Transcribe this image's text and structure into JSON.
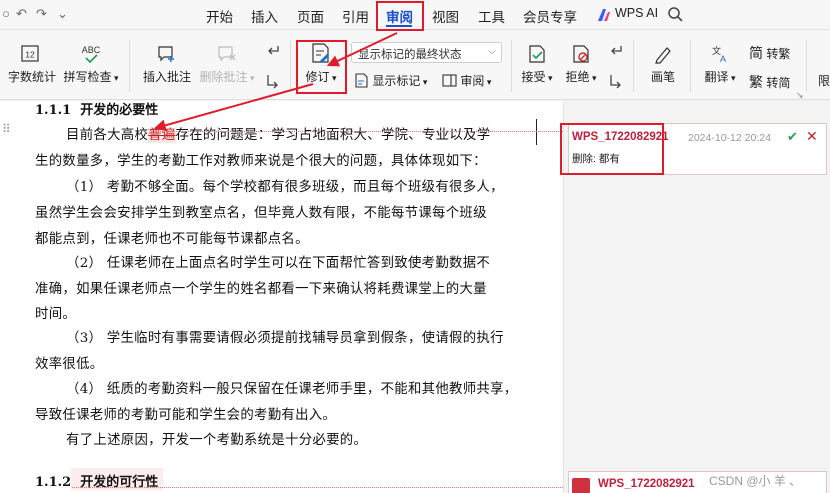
{
  "quick_access": {
    "dot": "○",
    "undo": "↶",
    "redo": "↷",
    "more": "⌄"
  },
  "menu": {
    "tabs": [
      "开始",
      "插入",
      "页面",
      "引用",
      "审阅",
      "视图",
      "工具",
      "会员专享"
    ],
    "active_tab": "审阅",
    "wps_ai_label": "WPS AI",
    "search_icon": "search-icon"
  },
  "ribbon": {
    "word_count": {
      "icon_text": "12",
      "label": "字数统计"
    },
    "spell_check": {
      "icon_text": "ABC",
      "label": "拼写检查"
    },
    "insert_comment": "插入批注",
    "delete_comment": "删除批注",
    "track_changes": "修订",
    "display_mode": "显示标记的最终状态",
    "show_markup": "显示标记",
    "review_pane": "审阅",
    "accept": "接受",
    "reject": "拒绝",
    "pen": "画笔",
    "translate": "翻译",
    "to_traditional": {
      "glyph": "简",
      "label": "转繁"
    },
    "to_simplified": {
      "glyph": "繁",
      "label": "转简"
    },
    "cut_label": "限"
  },
  "document": {
    "heading1_prefix": "1.1.1",
    "heading1_text": "开发的必要性",
    "para1_line1_before": "目前各大高校",
    "para1_line1_deleted": "普遍",
    "para1_line1_after": "存在的问题是：学习占地面积大、学院、专业以及学",
    "lines": [
      "生的数量多，学生的考勤工作对教师来说是个很大的问题，具体体现如下：",
      "（1） 考勤不够全面。每个学校都有很多班级，而且每个班级有很多人，",
      "虽然学生会会安排学生到教室点名，但毕竟人数有限，不能每节课每个班级",
      "都能点到，任课老师也不可能每节课都点名。",
      "（2） 任课老师在上面点名时学生可以在下面帮忙答到致使考勤数据不",
      "准确，如果任课老师点一个学生的姓名都看一下来确认将耗费课堂上的大量",
      "时间。",
      "（3） 学生临时有事需要请假必须提前找辅导员拿到假条，使请假的执行",
      "效率很低。",
      "（4） 纸质的考勤资料一般只保留在任课老师手里，不能和其他教师共享，",
      "导致任课老师的考勤可能和学生会的考勤有出入。",
      "有了上述原因，开发一个考勤系统是十分必要的。"
    ],
    "heading2_prefix": "1.1.2",
    "heading2_text": "开发的可行性"
  },
  "comments": [
    {
      "author": "WPS_1722082921",
      "time": "2024-10-12 20:24",
      "action": "删除:",
      "content": "都有",
      "accept": "✔",
      "reject": "✕"
    },
    {
      "author": "WPS_1722082921"
    }
  ],
  "watermark": "CSDN @小 羊 、",
  "colors": {
    "accent": "#1a4fd0",
    "revision": "#c0203a",
    "annotation": "#e01c2c"
  }
}
